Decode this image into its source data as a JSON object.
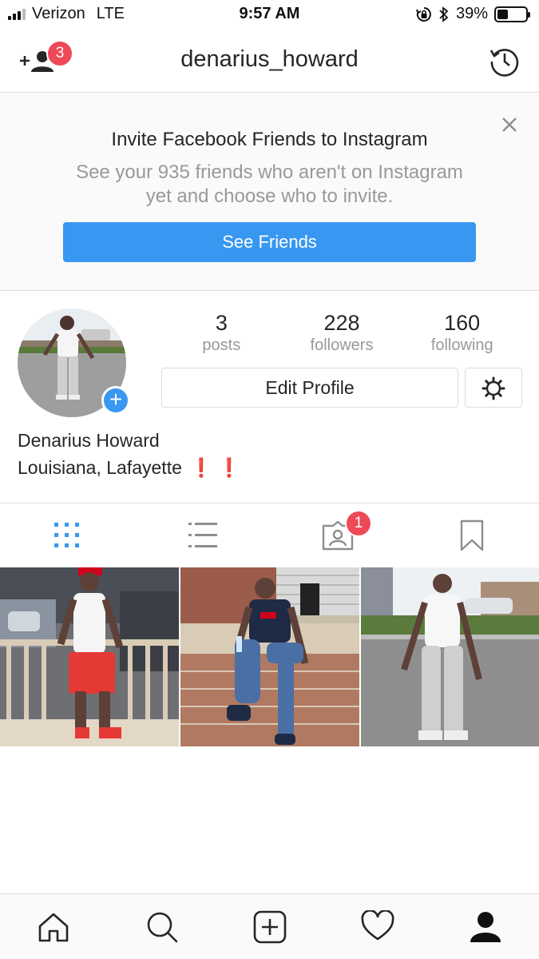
{
  "status_bar": {
    "carrier": "Verizon",
    "network": "LTE",
    "time": "9:57 AM",
    "battery_percent": "39%",
    "battery_level": 0.39,
    "signal_bars_active": 3,
    "signal_bars_total": 5,
    "icons": [
      "orientation-lock-icon",
      "bluetooth-icon",
      "battery-icon"
    ]
  },
  "header": {
    "username": "denarius_howard",
    "follow_requests_badge": "3",
    "left_icon": "add-person-icon",
    "right_icon": "history-icon"
  },
  "invite_banner": {
    "title": "Invite Facebook Friends to Instagram",
    "subtitle": "See your 935 friends who aren't on Instagram yet and choose who to invite.",
    "button_label": "See Friends",
    "close_icon": "close-icon"
  },
  "profile": {
    "stats": [
      {
        "value": "3",
        "label": "posts"
      },
      {
        "value": "228",
        "label": "followers"
      },
      {
        "value": "160",
        "label": "following"
      }
    ],
    "edit_button": "Edit Profile",
    "name": "Denarius Howard",
    "bio": "Louisiana, Lafayette",
    "bio_emoji": "❗ ❗"
  },
  "tabs": {
    "items": [
      "grid-icon",
      "list-icon",
      "tagged-icon",
      "bookmark-icon"
    ],
    "tagged_badge": "1",
    "active_color": "#3897f0"
  },
  "posts": [
    {
      "name": "post-red-outfit"
    },
    {
      "name": "post-navy-shirt-wall"
    },
    {
      "name": "post-white-shirt-lot"
    }
  ],
  "bottom_nav": {
    "items": [
      "home-icon",
      "search-icon",
      "new-post-icon",
      "activity-heart-icon",
      "profile-icon"
    ]
  },
  "colors": {
    "accent": "#3897f0",
    "badge": "#ed4956",
    "muted_text": "#999999",
    "border": "#dbdbdb"
  }
}
